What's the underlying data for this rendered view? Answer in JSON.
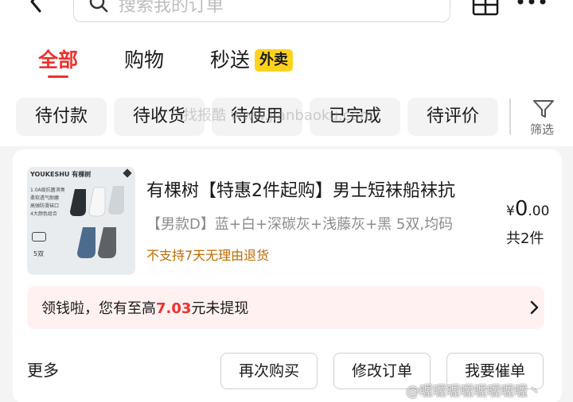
{
  "header": {
    "search_placeholder": "搜索我的订单"
  },
  "tabs": [
    {
      "label": "全部"
    },
    {
      "label": "购物"
    },
    {
      "label": "秒送"
    }
  ],
  "tabs_badge": "外卖",
  "filters": [
    {
      "label": "待付款"
    },
    {
      "label": "待收货"
    },
    {
      "label": "待使用"
    },
    {
      "label": "已完成"
    },
    {
      "label": "待评价"
    }
  ],
  "filter_button_label": "筛选",
  "watermark": "找报酷 www.jianbaoku.com",
  "order": {
    "product_image": {
      "brand": "YOUKESHU 有棵树",
      "features": [
        "1.0A级抗菌消臭",
        "柔软透气耐磨",
        "高弹防滑袜口",
        "4大颜色组合"
      ],
      "quantity": "5双"
    },
    "title": "有棵树【特惠2件起购】男士短袜船袜抗",
    "spec": "【男款D】蓝+白+深碳灰+浅藤灰+黑 5双,均码",
    "policy": "不支持7天无理由退货",
    "price_currency": "¥",
    "price_int": "0",
    "price_dec": ".00",
    "quantity": "共2件",
    "cashback": {
      "prefix": "领钱啦，您有至高",
      "amount": "7.03",
      "suffix": "元未提现"
    },
    "more_label": "更多",
    "buttons": [
      {
        "label": "再次购买"
      },
      {
        "label": "修改订单"
      },
      {
        "label": "我要催单"
      }
    ]
  },
  "weibo_watermark": "@喔喔喔喔喔喔喔喔丶"
}
